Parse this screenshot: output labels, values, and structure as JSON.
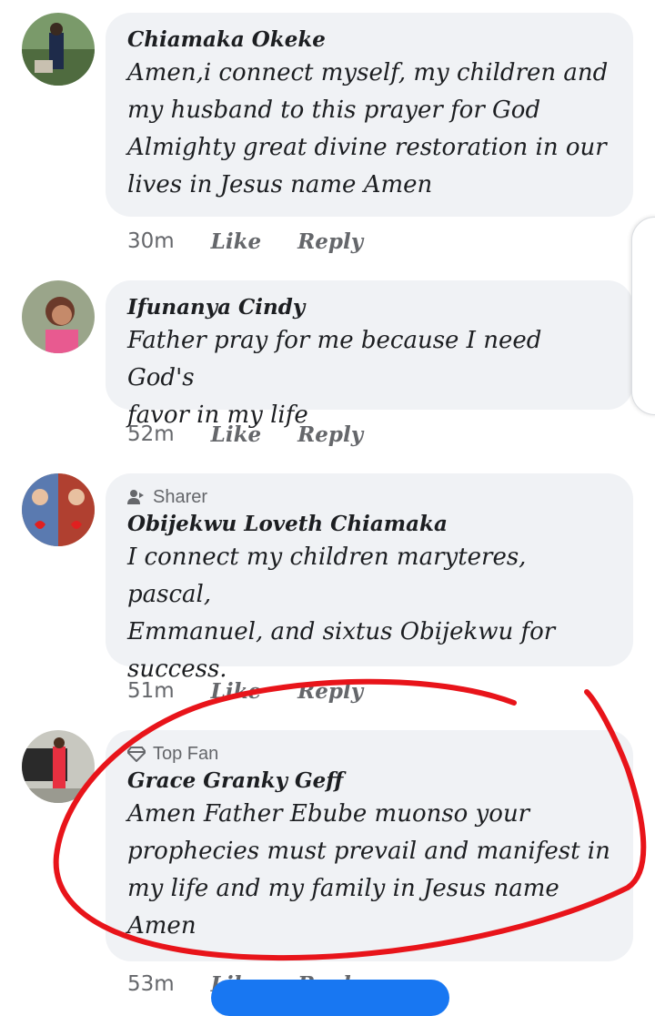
{
  "comments": [
    {
      "author": "Chiamaka Okeke",
      "badge": "",
      "lines": [
        "Amen,i connect myself, my children and",
        "my husband to this prayer for God",
        "Almighty great divine restoration in our",
        "lives in Jesus name Amen"
      ],
      "time": "30m",
      "like": "Like",
      "reply": "Reply"
    },
    {
      "author": "Ifunanya Cindy",
      "badge": "",
      "lines": [
        "Father pray for me because I need God's",
        "favor in my life"
      ],
      "time": "52m",
      "like": "Like",
      "reply": "Reply"
    },
    {
      "author": "Obijekwu Loveth Chiamaka",
      "badge": "Sharer",
      "lines": [
        "I connect my children maryteres, pascal,",
        "Emmanuel, and sixtus Obijekwu for",
        "success."
      ],
      "time": "51m",
      "like": "Like",
      "reply": "Reply"
    },
    {
      "author": "Grace Granky Geff",
      "badge": "Top Fan",
      "lines": [
        "Amen Father Ebube muonso your",
        "prophecies must prevail and manifest in",
        "my life and my family in Jesus name",
        "Amen"
      ],
      "time": "53m",
      "like": "Like",
      "reply": "Reply"
    }
  ],
  "colors": {
    "bubble": "#f0f2f5",
    "meta": "#65676b",
    "annotation": "#e8141a",
    "button": "#1877f2"
  }
}
